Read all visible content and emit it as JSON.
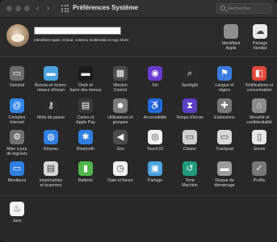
{
  "titlebar": {
    "title": "Préférences Système",
    "back": "‹",
    "forward": "›",
    "search_placeholder": "Rechercher",
    "lights": [
      "#5a5a5a",
      "#5a5a5a",
      "#5a5a5a"
    ]
  },
  "account": {
    "subtitle": "Identifiant Apple, iCloud, contenu multimédia et App Store",
    "items": [
      {
        "label": "Identifiant\nApple",
        "icon": "apple-id-icon",
        "glyph": "",
        "color": "#8e8e8e"
      },
      {
        "label": "Partage\nfamilial",
        "icon": "family-sharing-icon",
        "glyph": "☁",
        "color": "#e8e8e8"
      }
    ]
  },
  "rows": [
    [
      {
        "label": "Général",
        "icon": "general-icon",
        "glyph": "▭",
        "color": "#6b6b6b"
      },
      {
        "label": "Bureau et écono-\nmiseur d'écran",
        "icon": "desktop-screensaver-icon",
        "glyph": "▬",
        "color": "#4aa3df"
      },
      {
        "label": "Dock et\nbarre des menus",
        "icon": "dock-menubar-icon",
        "glyph": "▬",
        "color": "#1c1c1c"
      },
      {
        "label": "Mission\nControl",
        "icon": "mission-control-icon",
        "glyph": "▦",
        "color": "#4b4b4b"
      },
      {
        "label": "Siri",
        "icon": "siri-icon",
        "glyph": "◉",
        "color": "#6a3bd1"
      },
      {
        "label": "Spotlight",
        "icon": "spotlight-icon",
        "glyph": "⌕",
        "color": "#2b2b2b"
      },
      {
        "label": "Langue et\nrégion",
        "icon": "language-region-icon",
        "glyph": "⚑",
        "color": "#3b7be0"
      },
      {
        "label": "Notifications et\nconcentration",
        "icon": "notifications-icon",
        "glyph": "◧",
        "color": "#e0473b"
      }
    ],
    [
      {
        "label": "Comptes\nInternet",
        "icon": "internet-accounts-icon",
        "glyph": "@",
        "color": "#2f86e5"
      },
      {
        "label": "Mots de passe",
        "icon": "passwords-icon",
        "glyph": "⚷",
        "color": "#2b2b2b"
      },
      {
        "label": "Cartes et\nApple Pay",
        "icon": "wallet-applepay-icon",
        "glyph": "▤",
        "color": "#3a3a3a"
      },
      {
        "label": "Utilisateurs et\ngroupes",
        "icon": "users-groups-icon",
        "glyph": "☻",
        "color": "#7a7a7a"
      },
      {
        "label": "Accessibilité",
        "icon": "accessibility-icon",
        "glyph": "♿",
        "color": "#1e6fe0"
      },
      {
        "label": "Temps d'écran",
        "icon": "screen-time-icon",
        "glyph": "⧗",
        "color": "#5b3fc4"
      },
      {
        "label": "Extensions",
        "icon": "extensions-icon",
        "glyph": "✚",
        "color": "#777777"
      },
      {
        "label": "Sécurité et\nconfidentialité",
        "icon": "security-privacy-icon",
        "glyph": "⌂",
        "color": "#8a8a8a"
      }
    ],
    [
      {
        "label": "Mise à jour\nde logiciels",
        "icon": "software-update-icon",
        "glyph": "⚙",
        "color": "#6f6f6f"
      },
      {
        "label": "Réseau",
        "icon": "network-icon",
        "glyph": "◍",
        "color": "#2f7fe0"
      },
      {
        "label": "Bluetooth",
        "icon": "bluetooth-icon",
        "glyph": "✱",
        "color": "#2f7fe0"
      },
      {
        "label": "Son",
        "icon": "sound-icon",
        "glyph": "◀",
        "color": "#4a4a4a"
      },
      {
        "label": "Touch ID",
        "icon": "touch-id-icon",
        "glyph": "◎",
        "color": "#f2f2f2"
      },
      {
        "label": "Clavier",
        "icon": "keyboard-icon",
        "glyph": "▭",
        "color": "#cfcfcf"
      },
      {
        "label": "Trackpad",
        "icon": "trackpad-icon",
        "glyph": "▭",
        "color": "#d8d8d8"
      },
      {
        "label": "Souris",
        "icon": "mouse-icon",
        "glyph": "▯",
        "color": "#e6e6e6"
      }
    ],
    [
      {
        "label": "Moniteurs",
        "icon": "displays-icon",
        "glyph": "▭",
        "color": "#2f7fe0"
      },
      {
        "label": "Imprimantes\net scanners",
        "icon": "printers-scanners-icon",
        "glyph": "▤",
        "color": "#d8d8d8"
      },
      {
        "label": "Batterie",
        "icon": "battery-icon",
        "glyph": "▮",
        "color": "#4fb74a"
      },
      {
        "label": "Date et heure",
        "icon": "date-time-icon",
        "glyph": "◷",
        "color": "#f0f0f0"
      },
      {
        "label": "Partage",
        "icon": "sharing-icon",
        "glyph": "▣",
        "color": "#4aa3df"
      },
      {
        "label": "Time\nMachine",
        "icon": "time-machine-icon",
        "glyph": "↺",
        "color": "#1f9b7a"
      },
      {
        "label": "Disque de\ndémarrage",
        "icon": "startup-disk-icon",
        "glyph": "▬",
        "color": "#9a9a9a"
      },
      {
        "label": "Profils",
        "icon": "profiles-icon",
        "glyph": "✓",
        "color": "#777777"
      }
    ],
    [
      {
        "label": "Java",
        "icon": "java-icon",
        "glyph": "♨",
        "color": "#f3f3f3"
      }
    ]
  ]
}
